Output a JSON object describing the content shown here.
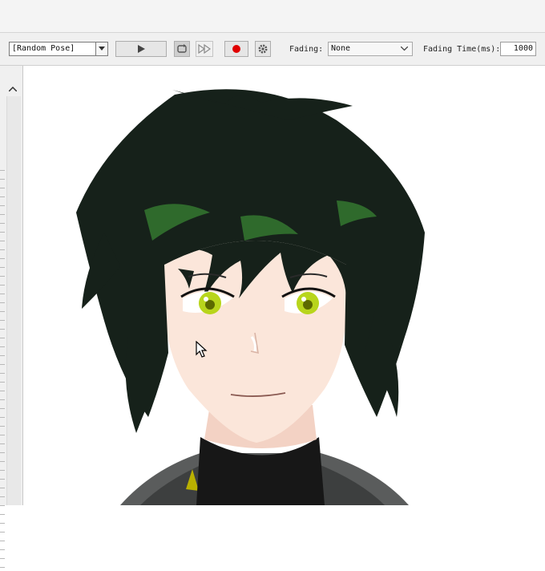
{
  "toolbar": {
    "pose_select": {
      "value": "[Random Pose]"
    },
    "fading": {
      "label": "Fading:",
      "value": "None"
    },
    "fading_time": {
      "label": "Fading Time(ms):",
      "value": "1000"
    }
  },
  "icons": {
    "play": "play-icon",
    "loop": "loop-icon",
    "fast_forward": "fast-forward-icon",
    "record": "record-icon",
    "settings": "gear-icon",
    "cursor": "mouse-cursor-icon"
  },
  "colors": {
    "record_red": "#e00000",
    "hair": "#16211a",
    "hair_highlight": "#2f6a2c",
    "eyes": "#b8d51c",
    "skin": "#fbe6da"
  }
}
